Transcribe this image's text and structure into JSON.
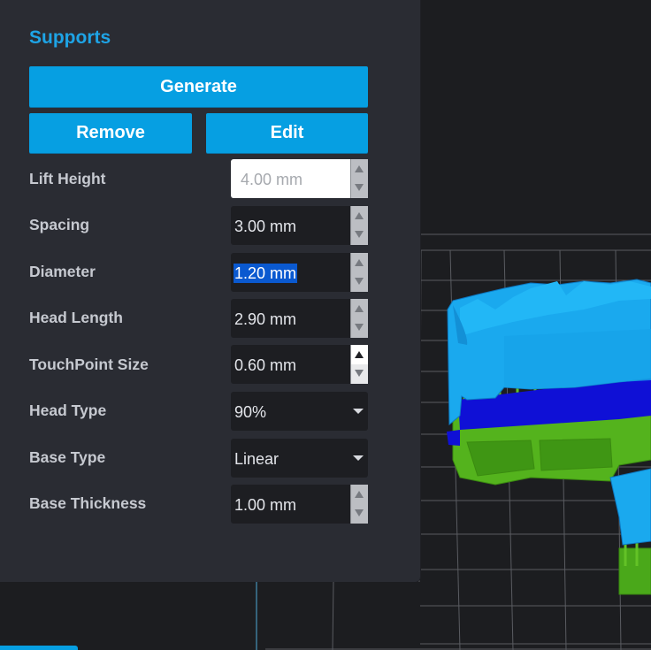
{
  "panel": {
    "title": "Supports",
    "buttons": {
      "generate": "Generate",
      "remove": "Remove",
      "edit": "Edit"
    },
    "fields": [
      {
        "label": "Lift Height",
        "value": "4.00 mm",
        "kind": "spinner",
        "state": "disabled"
      },
      {
        "label": "Spacing",
        "value": "3.00 mm",
        "kind": "spinner",
        "state": "normal"
      },
      {
        "label": "Diameter",
        "value": "1.20 mm",
        "kind": "spinner",
        "state": "selected"
      },
      {
        "label": "Head Length",
        "value": "2.90 mm",
        "kind": "spinner",
        "state": "normal"
      },
      {
        "label": "TouchPoint Size",
        "value": "0.60 mm",
        "kind": "spinner",
        "state": "spinner-hover"
      },
      {
        "label": "Head Type",
        "value": "90%",
        "kind": "dropdown"
      },
      {
        "label": "Base Type",
        "value": "Linear",
        "kind": "dropdown"
      },
      {
        "label": "Base Thickness",
        "value": "1.00 mm",
        "kind": "spinner",
        "state": "normal"
      }
    ]
  },
  "colors": {
    "accent": "#069fe2",
    "title": "#1ea4e6",
    "panel_bg": "#2a2c33",
    "field_bg": "#1d1e22",
    "model": "#1aa9ee",
    "model_base": "#0f10d6",
    "supports": "#54b31d",
    "selection": "#0a59d0"
  },
  "icons": {
    "spinner_up": "triangle-up-icon",
    "spinner_down": "triangle-down-icon",
    "dropdown": "caret-down-icon"
  }
}
